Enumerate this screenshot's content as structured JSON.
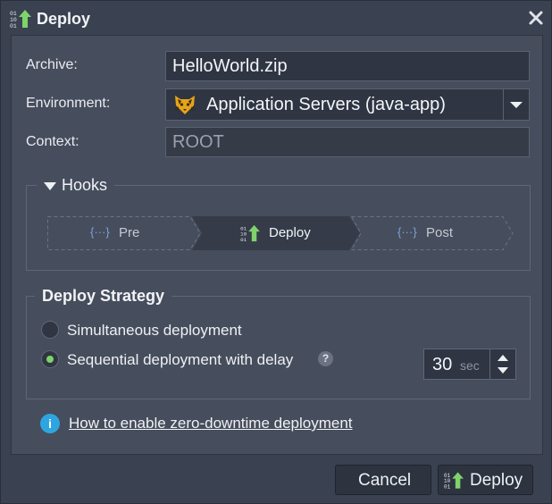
{
  "dialog": {
    "title": "Deploy",
    "title_icon": "deploy-icon",
    "close_icon": "close-icon"
  },
  "form": {
    "archive_label": "Archive:",
    "archive_value": "HelloWorld.zip",
    "environment_label": "Environment:",
    "environment_value": "Application Servers (java-app)",
    "environment_icon": "tomcat-icon",
    "context_label": "Context:",
    "context_value": "ROOT"
  },
  "hooks": {
    "label": "Hooks",
    "expanded": true,
    "steps": [
      {
        "label": "Pre",
        "icon": "hook-braces-icon",
        "active": false
      },
      {
        "label": "Deploy",
        "icon": "deploy-icon",
        "active": true
      },
      {
        "label": "Post",
        "icon": "hook-braces-icon",
        "active": false
      }
    ]
  },
  "strategy": {
    "label": "Deploy Strategy",
    "options": [
      {
        "label": "Simultaneous deployment",
        "selected": false
      },
      {
        "label": "Sequential deployment with delay",
        "selected": true
      }
    ],
    "help_icon": "?",
    "delay_value": "30",
    "delay_unit": "sec"
  },
  "info": {
    "link_text": "How to enable zero-downtime deployment",
    "icon": "i"
  },
  "buttons": {
    "cancel": "Cancel",
    "deploy": "Deploy"
  },
  "colors": {
    "accent_green": "#7ed36b",
    "info_blue": "#2ea5e0",
    "panel_bg": "#464d5c",
    "window_bg": "#3a4150"
  }
}
